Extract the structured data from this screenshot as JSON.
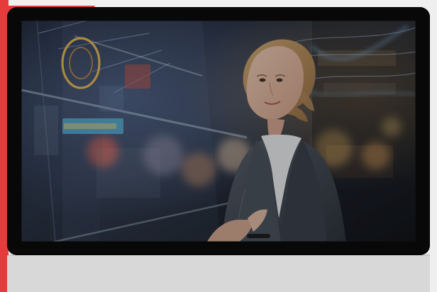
{
  "colors": {
    "accent": "#e53b3b"
  },
  "screen": {
    "content": "scene"
  }
}
